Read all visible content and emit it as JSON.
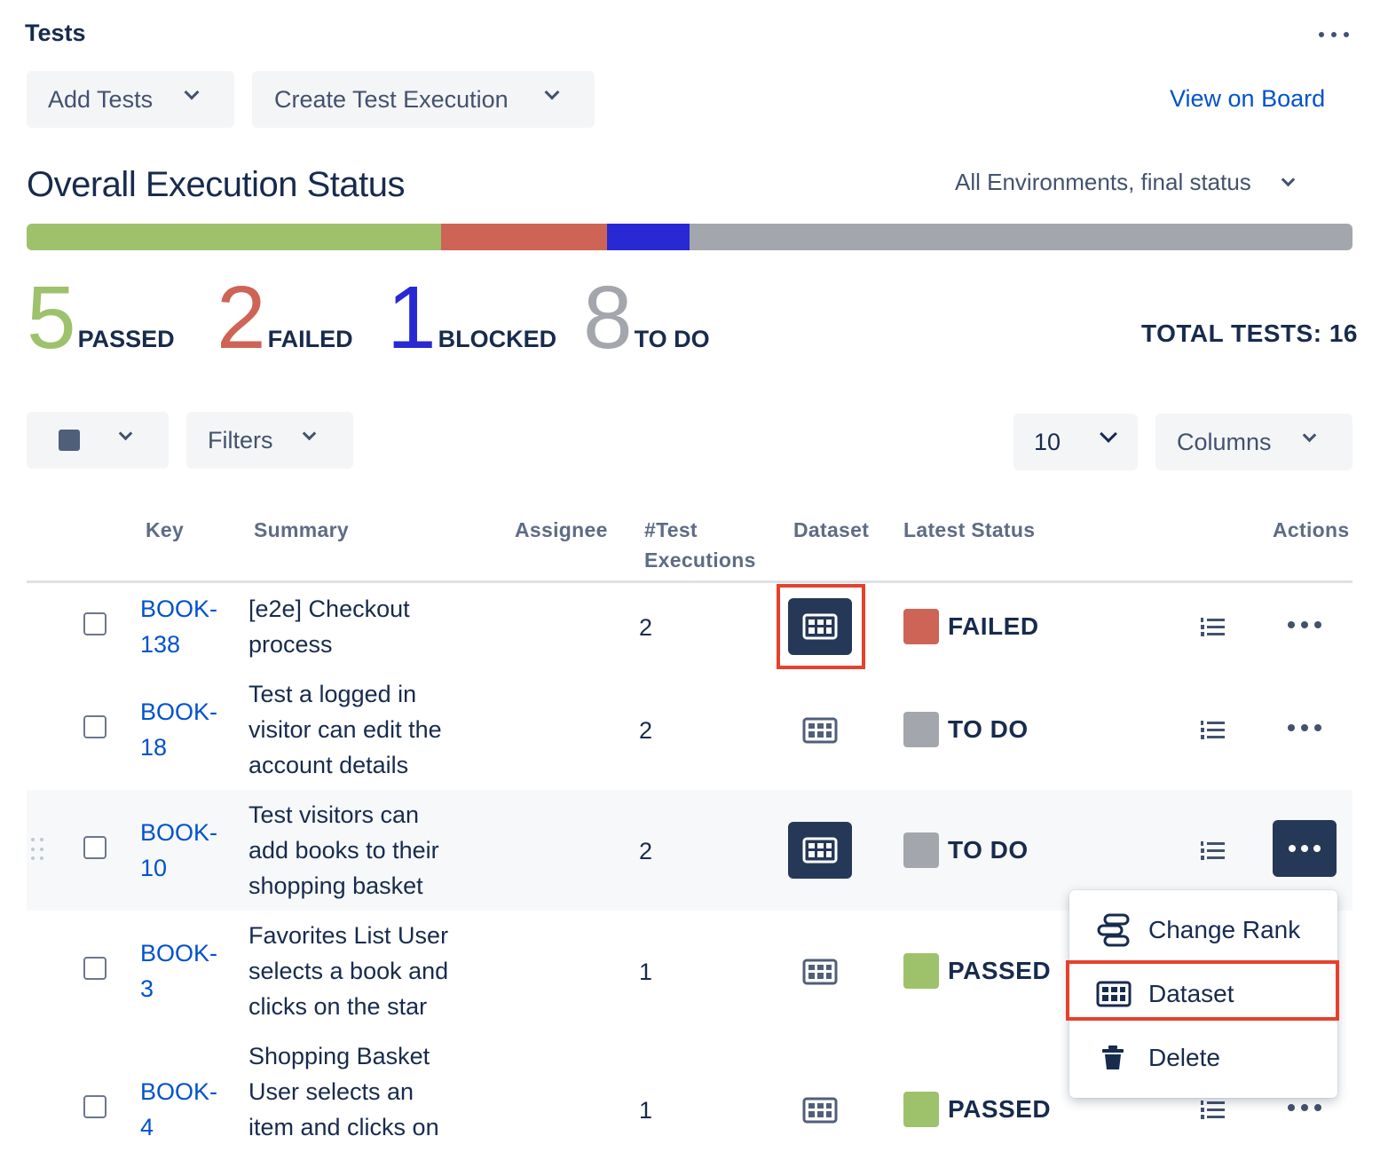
{
  "header": {
    "title": "Tests",
    "add_tests_label": "Add Tests",
    "create_exec_label": "Create Test Execution",
    "view_board_label": "View on Board"
  },
  "overall": {
    "title": "Overall Execution Status",
    "environment_label": "All Environments, final status",
    "total_label": "TOTAL TESTS: 16",
    "stats": [
      {
        "count": "5",
        "label": "PASSED",
        "color": "#9ec16c"
      },
      {
        "count": "2",
        "label": "FAILED",
        "color": "#cd6456"
      },
      {
        "count": "1",
        "label": "BLOCKED",
        "color": "#2929d4"
      },
      {
        "count": "8",
        "label": "TO DO",
        "color": "#a4a6ad"
      }
    ],
    "bar_fractions": [
      0.3125,
      0.125,
      0.0625,
      0.5
    ]
  },
  "toolbar": {
    "filters_label": "Filters",
    "page_size": "10",
    "columns_label": "Columns"
  },
  "table": {
    "headers": {
      "key": "Key",
      "summary": "Summary",
      "assignee": "Assignee",
      "execs_line1": "#Test",
      "execs_line2": "Executions",
      "dataset": "Dataset",
      "latest": "Latest Status",
      "actions": "Actions"
    },
    "rows": [
      {
        "key1": "BOOK-",
        "key2": "138",
        "summary": [
          "[e2e] Checkout",
          "process"
        ],
        "execs": "2",
        "status": "FAILED",
        "status_color": "#cd6456"
      },
      {
        "key1": "BOOK-",
        "key2": "18",
        "summary": [
          "Test a logged in",
          "visitor can edit the",
          "account details"
        ],
        "execs": "2",
        "status": "TO DO",
        "status_color": "#a4a6ad"
      },
      {
        "key1": "BOOK-",
        "key2": "10",
        "summary": [
          "Test visitors can",
          "add books to their",
          "shopping basket"
        ],
        "execs": "2",
        "status": "TO DO",
        "status_color": "#a4a6ad"
      },
      {
        "key1": "BOOK-",
        "key2": "3",
        "summary": [
          "Favorites List User",
          "selects a book and",
          "clicks on the star"
        ],
        "execs": "1",
        "status": "PASSED",
        "status_color": "#9ec16c"
      },
      {
        "key1": "BOOK-",
        "key2": "4",
        "summary": [
          "Shopping Basket",
          "User selects an",
          "item and clicks on"
        ],
        "execs": "1",
        "status": "PASSED",
        "status_color": "#9ec16c"
      }
    ]
  },
  "menu": {
    "items": [
      {
        "label": "Change Rank",
        "icon": "change-rank-icon"
      },
      {
        "label": "Dataset",
        "icon": "dataset-icon"
      },
      {
        "label": "Delete",
        "icon": "trash-icon"
      }
    ]
  },
  "colors": {
    "accent": "#0052cc",
    "dark_button": "#253858",
    "highlight": "#e5412d"
  }
}
